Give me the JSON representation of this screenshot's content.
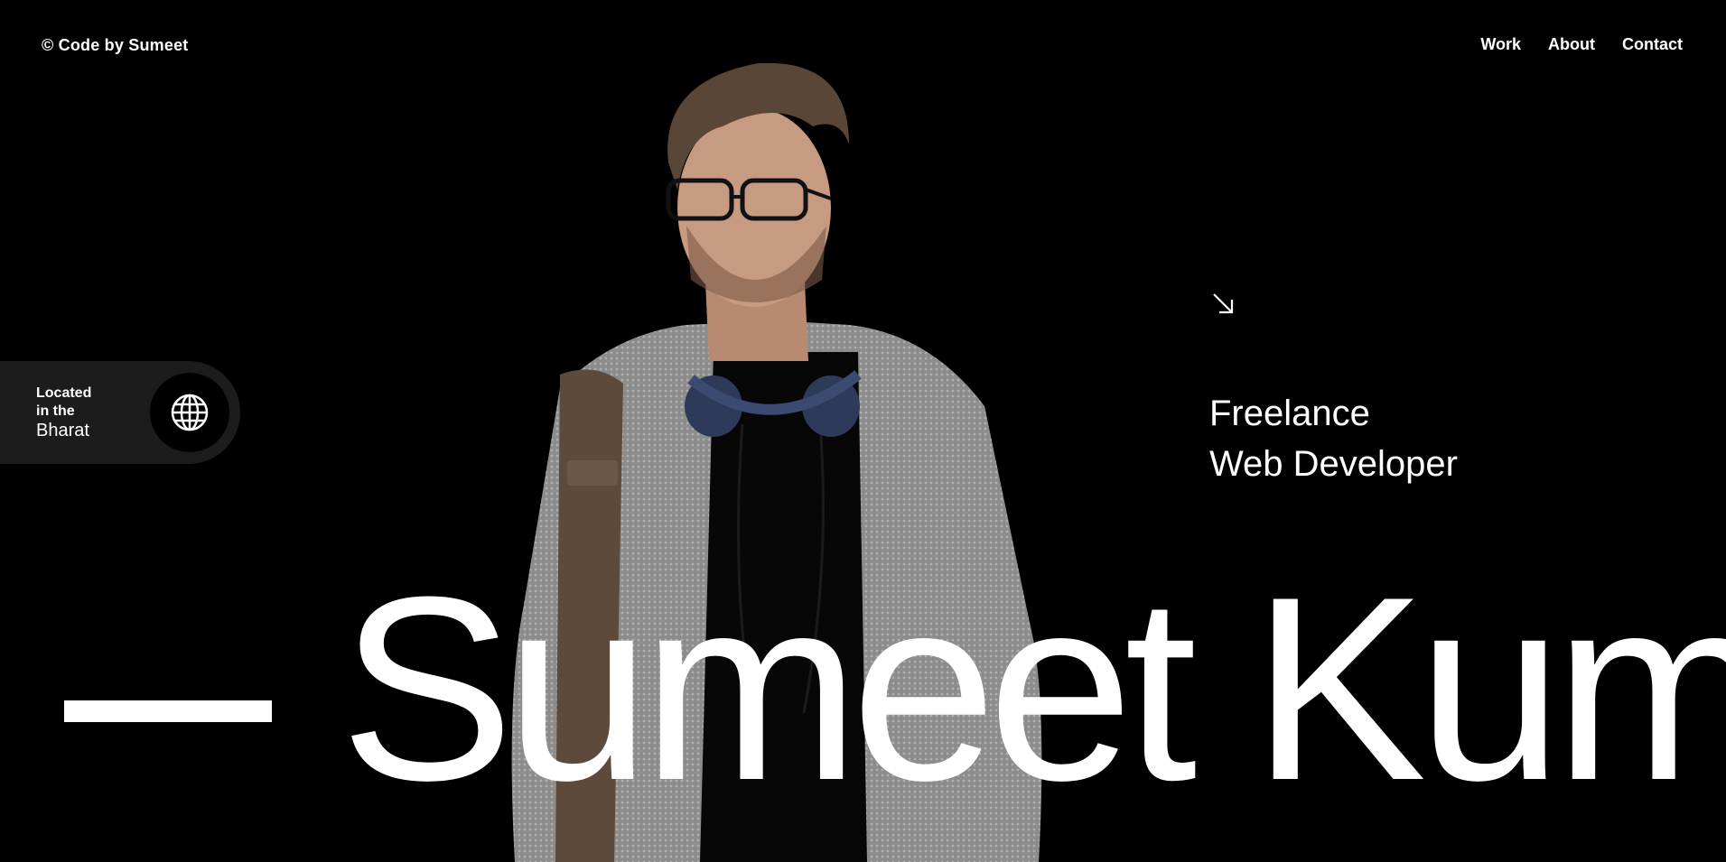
{
  "header": {
    "logo": "© Code by Sumeet",
    "nav": [
      {
        "label": "Work"
      },
      {
        "label": "About"
      },
      {
        "label": "Contact"
      }
    ]
  },
  "location": {
    "line1": "Located",
    "line2": "in the",
    "place": "Bharat",
    "icon": "globe-icon"
  },
  "hero": {
    "arrow_icon": "arrow-down-right-icon",
    "role_line1": "Freelance",
    "role_line2": "Web Developer",
    "name": "Sumeet Kum"
  },
  "colors": {
    "background": "#000000",
    "text": "#ffffff",
    "pill": "#1c1c1c"
  }
}
